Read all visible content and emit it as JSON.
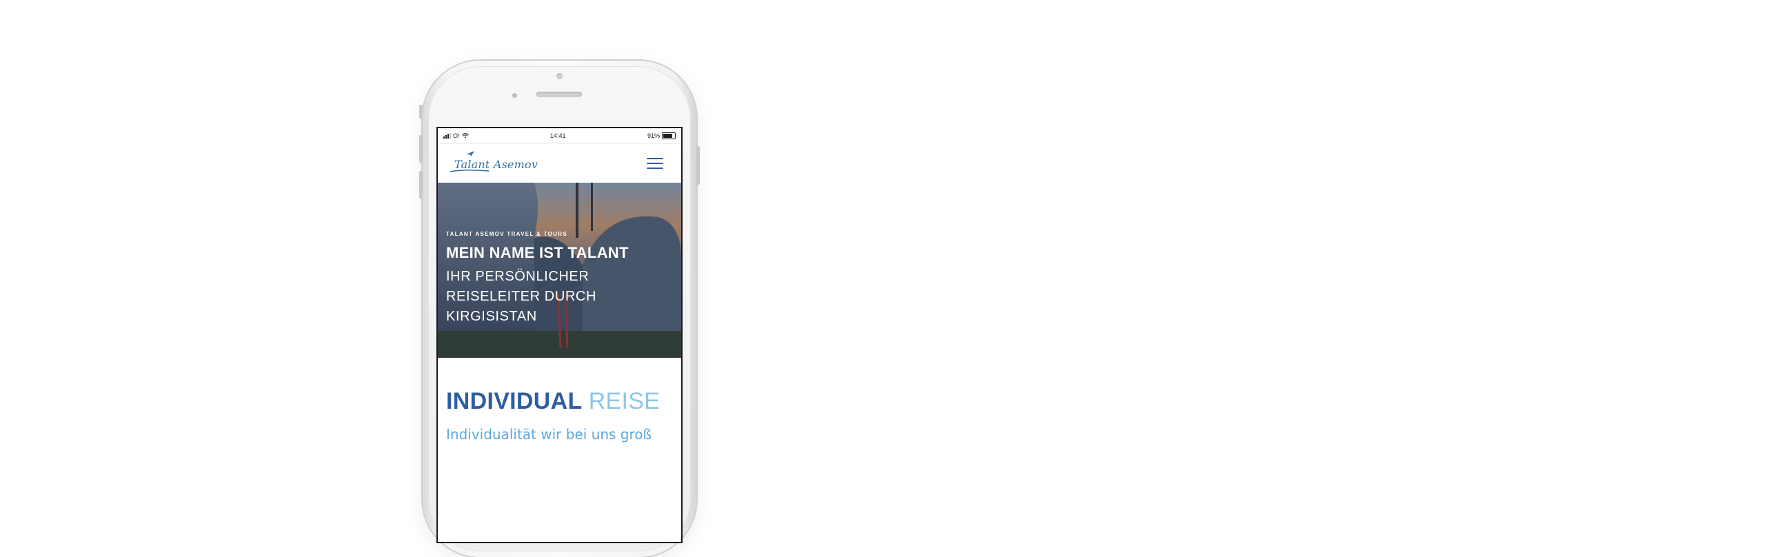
{
  "status_bar": {
    "carrier": "O!",
    "time": "14:41",
    "battery": "91%",
    "battery_level": 0.91
  },
  "nav": {
    "logo_text": "Talant Asemov"
  },
  "hero": {
    "caption": "TALANT ASEMOV TRAVEL & TOURS",
    "title": "MEIN NAME IST TALANT",
    "subtitle": "IHR PERSÖNLICHER REISELEITER DURCH KIRGISISTAN"
  },
  "section": {
    "title_bold": "INDIVIDUAL",
    "title_light": "REISE",
    "text": "Individualität wir bei uns groß"
  },
  "colors": {
    "brand_dark": "#2e5e9e",
    "brand_light": "#8cc6ea",
    "text_blue": "#5aa8dd"
  }
}
